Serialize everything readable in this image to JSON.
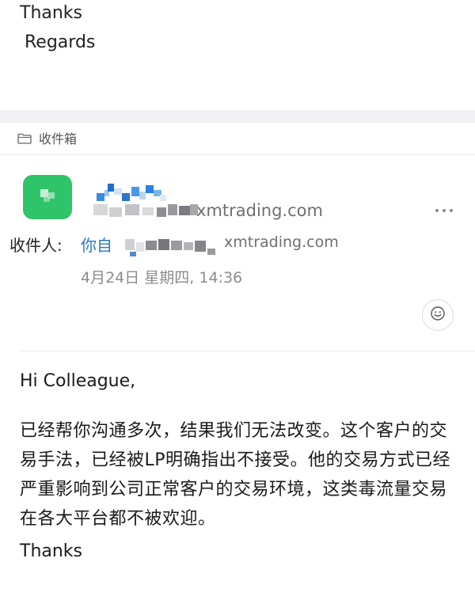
{
  "quoted_message": {
    "thanks": "Thanks",
    "regards": "Regards"
  },
  "folder": {
    "icon": "folder-icon",
    "label": "收件箱"
  },
  "header": {
    "sender_domain": "xmtrading.com",
    "more_icon": "more-icon",
    "to_label": "收件人:",
    "to_name_visible": "你自",
    "to_domain": "xmtrading.com",
    "date": "4月24日 星期四, 14:36",
    "reaction_icon": "smile-icon"
  },
  "body": {
    "greeting": "Hi Colleague,",
    "paragraph": "已经帮你沟通多次，结果我们无法改变。这个客户的交易手法，已经被LP明确指出不接受。他的交易方式已经严重影响到公司正常客户的交易环境，这类毒流量交易在各大平台都不被欢迎。",
    "closing": "Thanks"
  },
  "colors": {
    "avatar": "#2fc36a",
    "link": "#2a7ac0",
    "muted": "#8c8c8f"
  }
}
